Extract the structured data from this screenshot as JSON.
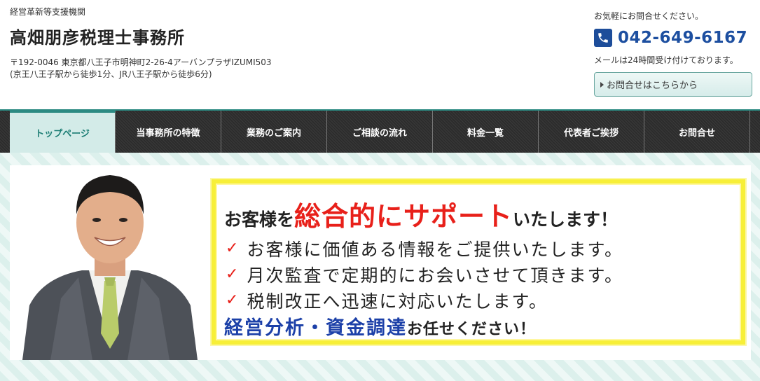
{
  "header": {
    "tagline": "経営革新等支援機関",
    "office_name": "高畑朋彦税理士事務所",
    "address_line1": "〒192-0046 東京都八王子市明神町2-26-4アーバンプラザIZUMI503",
    "address_line2": "(京王八王子駅から徒歩1分、JR八王子駅から徒歩6分)"
  },
  "contact": {
    "note": "お気軽にお問合せください。",
    "phone": "042-649-6167",
    "mail_note": "メールは24時間受け付けております。",
    "button_label": "お問合せはこちらから"
  },
  "nav": {
    "items": [
      {
        "label": "トップページ",
        "active": true
      },
      {
        "label": "当事務所の特徴"
      },
      {
        "label": "業務のご案内"
      },
      {
        "label": "ご相談の流れ"
      },
      {
        "label": "料金一覧"
      },
      {
        "label": "代表者ご挨拶"
      },
      {
        "label": "お問合せ"
      }
    ]
  },
  "hero": {
    "headline_pre": "お客様を",
    "headline_emphasis": "総合的にサポート",
    "headline_post": "いたします！",
    "bullets": [
      "お客様に価値ある情報をご提供いたします。",
      "月次監査で定期的にお会いさせて頂きます。",
      "税制改正へ迅速に対応いたします。"
    ],
    "closing_emphasis": "経営分析・資金調達",
    "closing_post": "お任せください！"
  },
  "colors": {
    "accent_teal": "#2b8a82",
    "phone_blue": "#1d4fa0",
    "headline_red": "#e8201a",
    "closing_blue": "#1c40a8",
    "banner_border": "#f7ef38"
  }
}
